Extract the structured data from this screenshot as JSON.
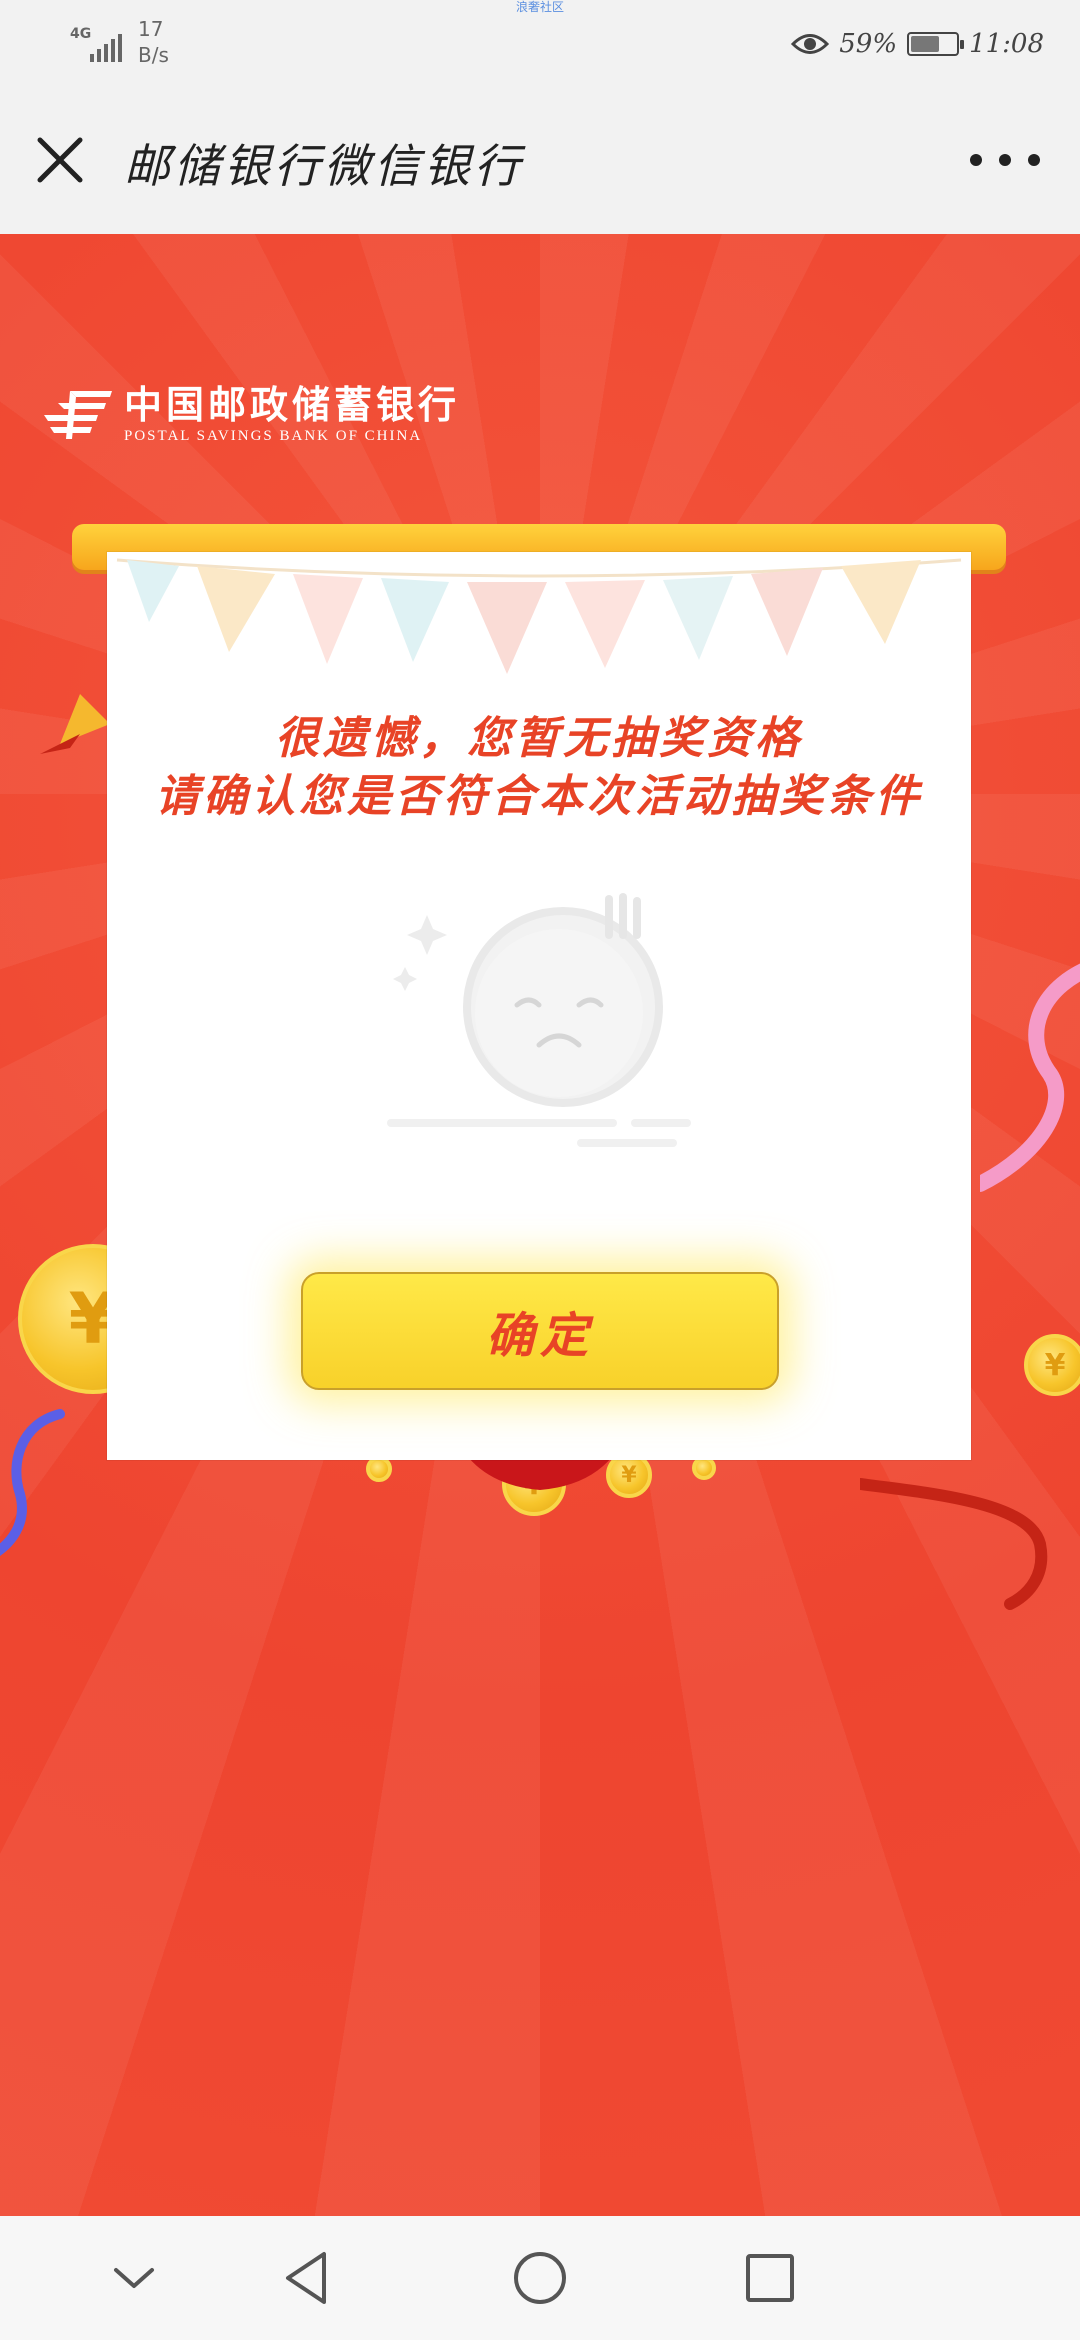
{
  "status_bar": {
    "watermark": "浪奢社区",
    "network_type": "4G",
    "speed_value": "17",
    "speed_unit": "B/s",
    "battery_percent": "59%",
    "time": "11:08"
  },
  "title_bar": {
    "title": "邮储银行微信银行"
  },
  "bank": {
    "name_cn": "中国邮政储蓄银行",
    "name_en": "POSTAL SAVINGS BANK OF CHINA"
  },
  "dialog": {
    "message_line1": "很遗憾，您暂无抽奖资格",
    "message_line2": "请确认您是否符合本次活动抽奖条件",
    "confirm_label": "确定"
  },
  "coin_symbol": "¥",
  "colors": {
    "background": "#f04a33",
    "accent_text": "#e84326",
    "button_yellow": "#fbe03a",
    "frame_orange": "#fbb32a"
  },
  "icons": {
    "close": "close-icon",
    "more": "more-icon",
    "nav_collapse": "chevron-down-icon",
    "nav_back": "back-triangle-icon",
    "nav_home": "home-circle-icon",
    "nav_recents": "recents-square-icon"
  }
}
